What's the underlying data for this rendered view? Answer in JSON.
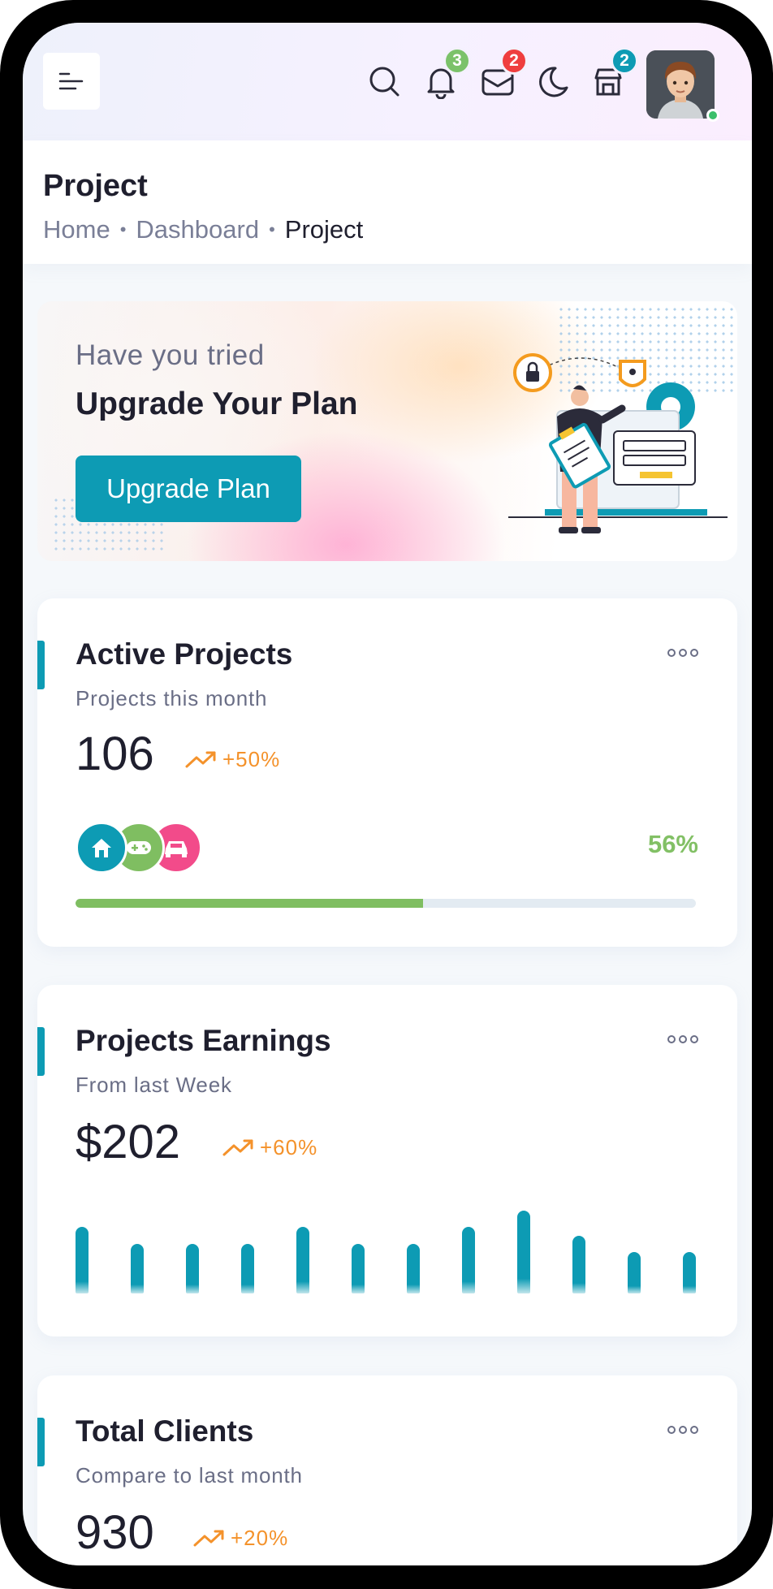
{
  "header": {
    "menu_icon": "menu-icon",
    "icons": [
      {
        "name": "search-icon"
      },
      {
        "name": "bell-icon",
        "badge": "3",
        "badge_color": "#7bc26a"
      },
      {
        "name": "mail-icon",
        "badge": "2",
        "badge_color": "#ef3e3e"
      },
      {
        "name": "moon-icon"
      },
      {
        "name": "shop-icon",
        "badge": "2",
        "badge_color": "#0d9bb4"
      }
    ],
    "avatar": "user-avatar"
  },
  "page": {
    "title": "Project",
    "breadcrumb": [
      "Home",
      "Dashboard",
      "Project"
    ]
  },
  "promo": {
    "subtitle": "Have you tried",
    "title": "Upgrade Your Plan",
    "button": "Upgrade Plan"
  },
  "active_projects": {
    "title": "Active Projects",
    "subtitle": "Projects this month",
    "value": "106",
    "trend": "+50%",
    "percent": "56%",
    "progress": 0.56,
    "avatars": [
      {
        "icon": "home-icon",
        "color": "#0d9bb4"
      },
      {
        "icon": "gamepad-icon",
        "color": "#7fbe61"
      },
      {
        "icon": "car-icon",
        "color": "#f24b8a"
      }
    ]
  },
  "projects_earnings": {
    "title": "Projects Earnings",
    "subtitle": "From last Week",
    "value": "$202",
    "trend": "+60%",
    "chart_data": {
      "type": "bar",
      "values": [
        80,
        60,
        60,
        60,
        80,
        60,
        60,
        80,
        100,
        70,
        50,
        50
      ]
    }
  },
  "total_clients": {
    "title": "Total Clients",
    "subtitle": "Compare to last month",
    "value": "930",
    "trend": "+20%"
  },
  "colors": {
    "accent": "#0d9bb4",
    "success": "#7fbe61",
    "trend": "#f4922b"
  }
}
